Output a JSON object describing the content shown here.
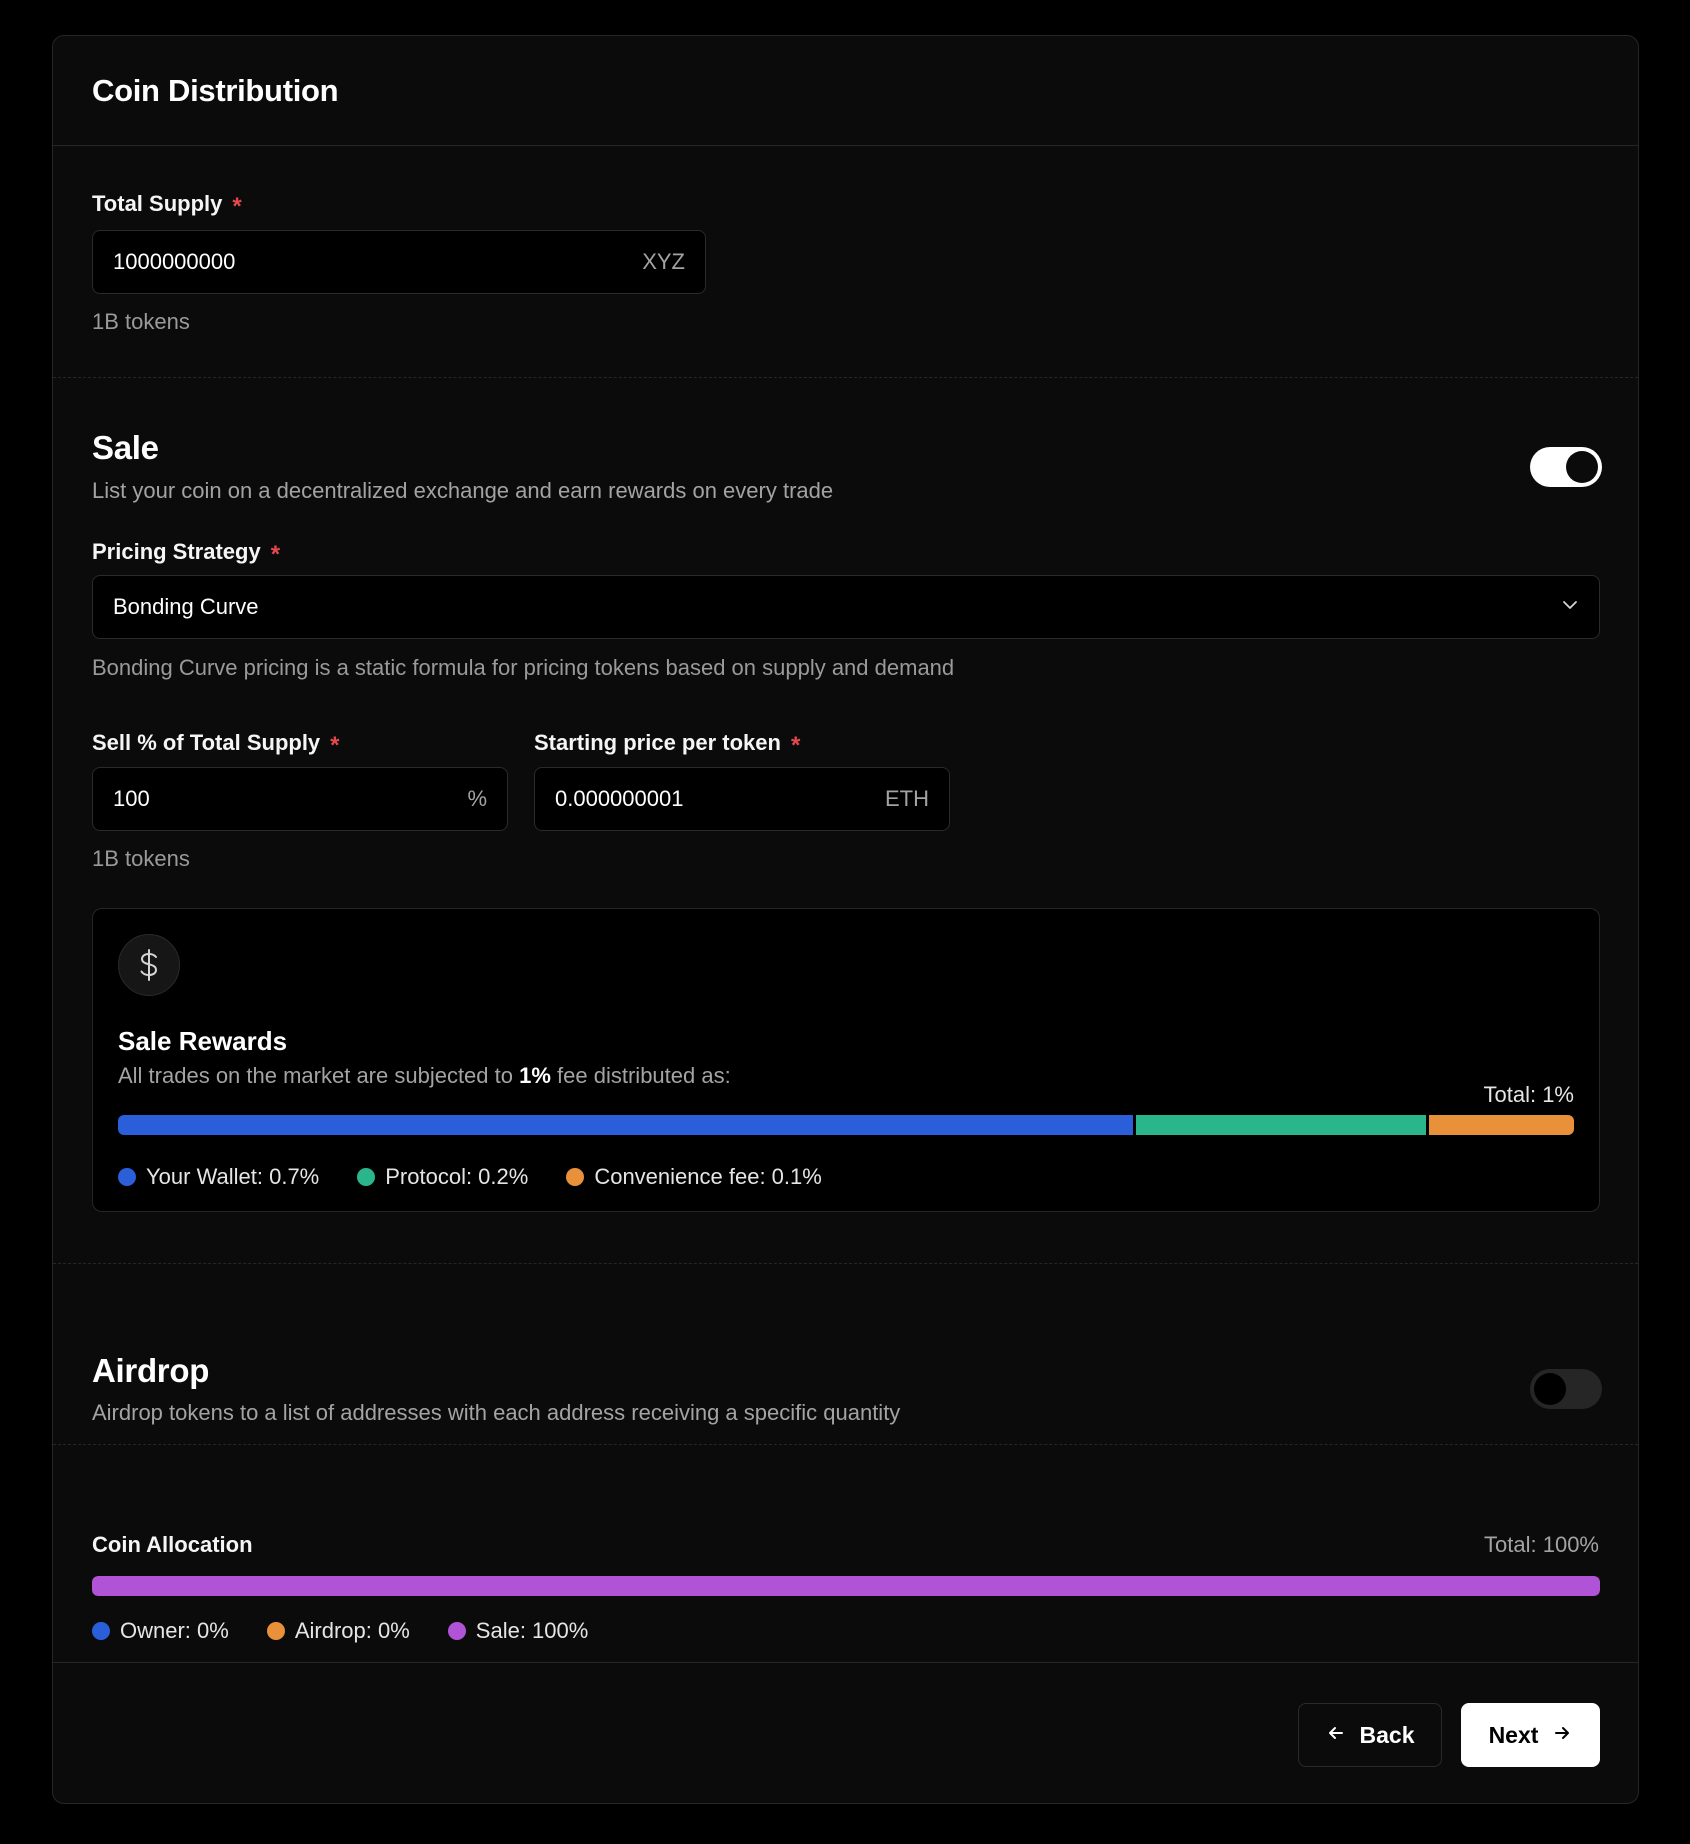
{
  "header": {
    "title": "Coin Distribution"
  },
  "total_supply": {
    "label": "Total Supply",
    "required_mark": "*",
    "value": "1000000000",
    "unit": "XYZ",
    "hint": "1B tokens"
  },
  "sale": {
    "title": "Sale",
    "subtitle": "List your coin on a decentralized exchange and earn rewards on every trade",
    "enabled": true,
    "pricing": {
      "label": "Pricing Strategy",
      "required_mark": "*",
      "selected": "Bonding Curve",
      "hint": "Bonding Curve pricing is a static formula for pricing tokens based on supply and demand"
    },
    "sell_percent": {
      "label": "Sell % of Total Supply",
      "required_mark": "*",
      "value": "100",
      "unit": "%",
      "hint": "1B tokens"
    },
    "start_price": {
      "label": "Starting price per token",
      "required_mark": "*",
      "value": "0.000000001",
      "unit": "ETH"
    },
    "rewards": {
      "icon": "dollar-icon",
      "title": "Sale Rewards",
      "desc_prefix": "All trades on the market are subjected to",
      "desc_fee": "1%",
      "desc_suffix": "fee distributed as:",
      "total": "Total: 1%",
      "segments": [
        {
          "label": "Your Wallet: 0.7%",
          "value": 0.7,
          "color": "#2b5fd9"
        },
        {
          "label": "Protocol: 0.2%",
          "value": 0.2,
          "color": "#2bb58a"
        },
        {
          "label": "Convenience fee: 0.1%",
          "value": 0.1,
          "color": "#e8913a"
        }
      ]
    }
  },
  "airdrop": {
    "title": "Airdrop",
    "subtitle": "Airdrop tokens to a list of addresses with each address receiving a specific quantity",
    "enabled": false
  },
  "allocation": {
    "title": "Coin Allocation",
    "total": "Total: 100%",
    "bar_color": "#b153d6",
    "bar_fill": 1.0,
    "items": [
      {
        "label": "Owner: 0%",
        "color": "#2b5fd9"
      },
      {
        "label": "Airdrop: 0%",
        "color": "#e8913a"
      },
      {
        "label": "Sale: 100%",
        "color": "#b153d6"
      }
    ]
  },
  "footer": {
    "back_label": "Back",
    "next_label": "Next",
    "back_icon": "arrow-left-icon",
    "next_icon": "arrow-right-icon"
  }
}
